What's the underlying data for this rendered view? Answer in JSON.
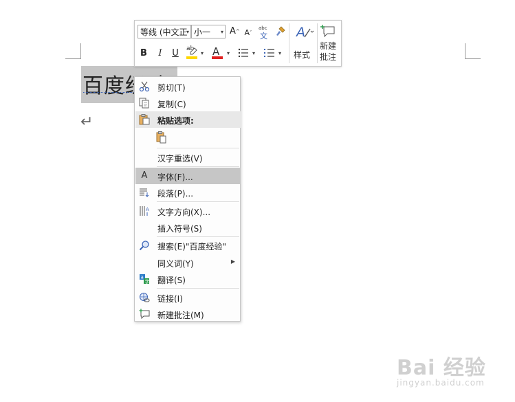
{
  "document": {
    "text": "百度经验",
    "paragraph_mark": "↵"
  },
  "mini_toolbar": {
    "font_name": "等线 (中文正",
    "font_size": "小一",
    "grow_font_glyph": "A",
    "shrink_font_glyph": "A",
    "phonetic_guide": {
      "top": "abc",
      "bottom": "文"
    },
    "bold": "B",
    "italic": "I",
    "underline": "U",
    "highlight_text": "ab",
    "font_color_glyph": "A",
    "styles_label": "样式",
    "new_comment_label_line1": "新建",
    "new_comment_label_line2": "批注",
    "colors": {
      "highlight": "#ffd800",
      "font_color": "#e02020",
      "accent": "#3a63b6"
    }
  },
  "context_menu": {
    "items": [
      {
        "icon": "scissors-icon",
        "label": "剪切(T)"
      },
      {
        "icon": "copy-icon",
        "label": "复制(C)"
      },
      {
        "icon": "clipboard-icon",
        "label": "粘贴选项:"
      },
      {
        "icon": "paste-keep-text-icon",
        "label": ""
      },
      {
        "icon": "",
        "label": "汉字重选(V)"
      },
      {
        "icon": "font-icon",
        "label": "字体(F)..."
      },
      {
        "icon": "paragraph-icon",
        "label": "段落(P)..."
      },
      {
        "icon": "text-direction-icon",
        "label": "文字方向(X)..."
      },
      {
        "icon": "",
        "label": "插入符号(S)"
      },
      {
        "icon": "search-icon",
        "label": "搜索(E)\"百度经验\""
      },
      {
        "icon": "",
        "label": "同义词(Y)"
      },
      {
        "icon": "translate-icon",
        "label": "翻译(S)"
      },
      {
        "icon": "link-icon",
        "label": "链接(I)"
      },
      {
        "icon": "new-comment-icon",
        "label": "新建批注(M)"
      }
    ]
  },
  "watermark": {
    "brand": "Bai 经验",
    "url": "jingyan.baidu.com"
  }
}
